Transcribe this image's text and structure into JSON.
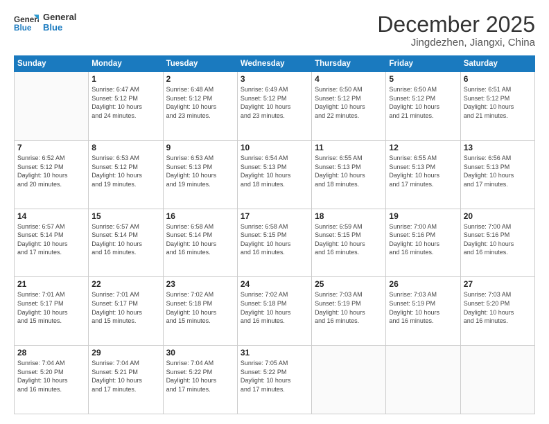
{
  "header": {
    "logo_line1": "General",
    "logo_line2": "Blue",
    "month": "December 2025",
    "location": "Jingdezhen, Jiangxi, China"
  },
  "weekdays": [
    "Sunday",
    "Monday",
    "Tuesday",
    "Wednesday",
    "Thursday",
    "Friday",
    "Saturday"
  ],
  "weeks": [
    [
      {
        "day": "",
        "info": ""
      },
      {
        "day": "1",
        "info": "Sunrise: 6:47 AM\nSunset: 5:12 PM\nDaylight: 10 hours\nand 24 minutes."
      },
      {
        "day": "2",
        "info": "Sunrise: 6:48 AM\nSunset: 5:12 PM\nDaylight: 10 hours\nand 23 minutes."
      },
      {
        "day": "3",
        "info": "Sunrise: 6:49 AM\nSunset: 5:12 PM\nDaylight: 10 hours\nand 23 minutes."
      },
      {
        "day": "4",
        "info": "Sunrise: 6:50 AM\nSunset: 5:12 PM\nDaylight: 10 hours\nand 22 minutes."
      },
      {
        "day": "5",
        "info": "Sunrise: 6:50 AM\nSunset: 5:12 PM\nDaylight: 10 hours\nand 21 minutes."
      },
      {
        "day": "6",
        "info": "Sunrise: 6:51 AM\nSunset: 5:12 PM\nDaylight: 10 hours\nand 21 minutes."
      }
    ],
    [
      {
        "day": "7",
        "info": "Sunrise: 6:52 AM\nSunset: 5:12 PM\nDaylight: 10 hours\nand 20 minutes."
      },
      {
        "day": "8",
        "info": "Sunrise: 6:53 AM\nSunset: 5:12 PM\nDaylight: 10 hours\nand 19 minutes."
      },
      {
        "day": "9",
        "info": "Sunrise: 6:53 AM\nSunset: 5:13 PM\nDaylight: 10 hours\nand 19 minutes."
      },
      {
        "day": "10",
        "info": "Sunrise: 6:54 AM\nSunset: 5:13 PM\nDaylight: 10 hours\nand 18 minutes."
      },
      {
        "day": "11",
        "info": "Sunrise: 6:55 AM\nSunset: 5:13 PM\nDaylight: 10 hours\nand 18 minutes."
      },
      {
        "day": "12",
        "info": "Sunrise: 6:55 AM\nSunset: 5:13 PM\nDaylight: 10 hours\nand 17 minutes."
      },
      {
        "day": "13",
        "info": "Sunrise: 6:56 AM\nSunset: 5:13 PM\nDaylight: 10 hours\nand 17 minutes."
      }
    ],
    [
      {
        "day": "14",
        "info": "Sunrise: 6:57 AM\nSunset: 5:14 PM\nDaylight: 10 hours\nand 17 minutes."
      },
      {
        "day": "15",
        "info": "Sunrise: 6:57 AM\nSunset: 5:14 PM\nDaylight: 10 hours\nand 16 minutes."
      },
      {
        "day": "16",
        "info": "Sunrise: 6:58 AM\nSunset: 5:14 PM\nDaylight: 10 hours\nand 16 minutes."
      },
      {
        "day": "17",
        "info": "Sunrise: 6:58 AM\nSunset: 5:15 PM\nDaylight: 10 hours\nand 16 minutes."
      },
      {
        "day": "18",
        "info": "Sunrise: 6:59 AM\nSunset: 5:15 PM\nDaylight: 10 hours\nand 16 minutes."
      },
      {
        "day": "19",
        "info": "Sunrise: 7:00 AM\nSunset: 5:16 PM\nDaylight: 10 hours\nand 16 minutes."
      },
      {
        "day": "20",
        "info": "Sunrise: 7:00 AM\nSunset: 5:16 PM\nDaylight: 10 hours\nand 16 minutes."
      }
    ],
    [
      {
        "day": "21",
        "info": "Sunrise: 7:01 AM\nSunset: 5:17 PM\nDaylight: 10 hours\nand 15 minutes."
      },
      {
        "day": "22",
        "info": "Sunrise: 7:01 AM\nSunset: 5:17 PM\nDaylight: 10 hours\nand 15 minutes."
      },
      {
        "day": "23",
        "info": "Sunrise: 7:02 AM\nSunset: 5:18 PM\nDaylight: 10 hours\nand 15 minutes."
      },
      {
        "day": "24",
        "info": "Sunrise: 7:02 AM\nSunset: 5:18 PM\nDaylight: 10 hours\nand 16 minutes."
      },
      {
        "day": "25",
        "info": "Sunrise: 7:03 AM\nSunset: 5:19 PM\nDaylight: 10 hours\nand 16 minutes."
      },
      {
        "day": "26",
        "info": "Sunrise: 7:03 AM\nSunset: 5:19 PM\nDaylight: 10 hours\nand 16 minutes."
      },
      {
        "day": "27",
        "info": "Sunrise: 7:03 AM\nSunset: 5:20 PM\nDaylight: 10 hours\nand 16 minutes."
      }
    ],
    [
      {
        "day": "28",
        "info": "Sunrise: 7:04 AM\nSunset: 5:20 PM\nDaylight: 10 hours\nand 16 minutes."
      },
      {
        "day": "29",
        "info": "Sunrise: 7:04 AM\nSunset: 5:21 PM\nDaylight: 10 hours\nand 17 minutes."
      },
      {
        "day": "30",
        "info": "Sunrise: 7:04 AM\nSunset: 5:22 PM\nDaylight: 10 hours\nand 17 minutes."
      },
      {
        "day": "31",
        "info": "Sunrise: 7:05 AM\nSunset: 5:22 PM\nDaylight: 10 hours\nand 17 minutes."
      },
      {
        "day": "",
        "info": ""
      },
      {
        "day": "",
        "info": ""
      },
      {
        "day": "",
        "info": ""
      }
    ]
  ]
}
